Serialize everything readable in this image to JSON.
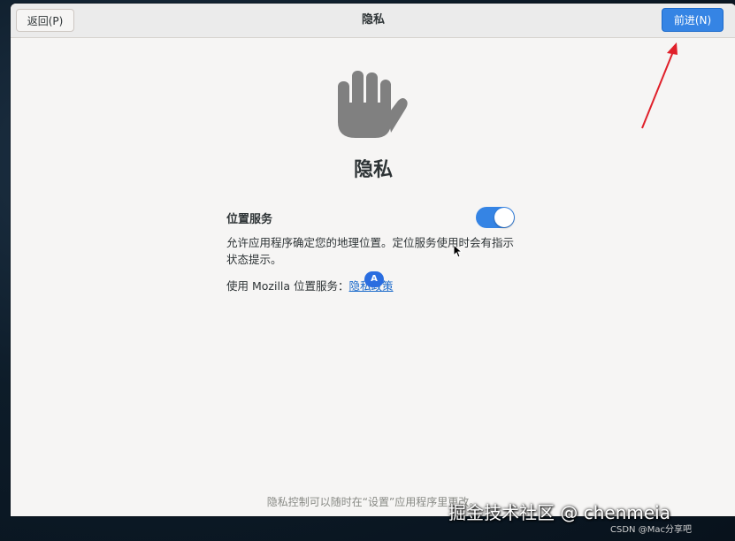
{
  "header": {
    "back_label": "返回(P)",
    "title": "隐私",
    "next_label": "前进(N)"
  },
  "main": {
    "title": "隐私",
    "icon": "hand-icon",
    "location": {
      "label": "位置服务",
      "enabled": true,
      "description": "允许应用程序确定您的地理位置。定位服务使用时会有指示状态提示。",
      "mozilla_prefix": "使用 Mozilla 位置服务：",
      "mozilla_link": "隐私政策"
    },
    "badge": "A"
  },
  "footer": {
    "note": "隐私控制可以随时在“设置”应用程序里更改。"
  },
  "overlay": {
    "watermark": "掘金技术社区 @ chenmeia",
    "csdn": "CSDN @Mac分享吧",
    "arrow_color": "#e0202a"
  },
  "colors": {
    "accent": "#3584e4",
    "link": "#1b6acb",
    "icon": "#808080"
  }
}
